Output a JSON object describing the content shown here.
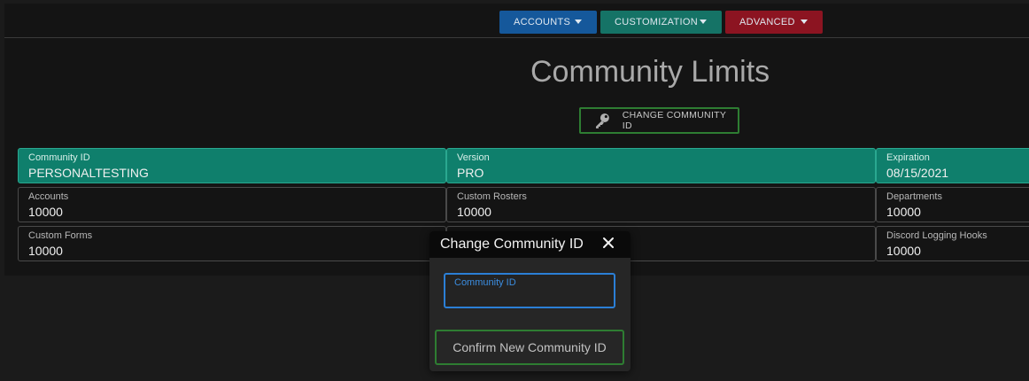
{
  "nav": {
    "accounts": "ACCOUNTS",
    "customization": "CUSTOMIZATION",
    "advanced": "ADVANCED"
  },
  "page": {
    "title": "Community Limits",
    "change_button": "CHANGE COMMUNITY ID"
  },
  "grid": {
    "community_id": {
      "label": "Community ID",
      "value": "PERSONALTESTING"
    },
    "version": {
      "label": "Version",
      "value": "PRO"
    },
    "expiration": {
      "label": "Expiration",
      "value": "08/15/2021"
    },
    "accounts": {
      "label": "Accounts",
      "value": "10000"
    },
    "custom_rosters": {
      "label": "Custom Rosters",
      "value": "10000"
    },
    "departments": {
      "label": "Departments",
      "value": "10000"
    },
    "custom_forms": {
      "label": "Custom Forms",
      "value": "10000"
    },
    "hidden_middle": {
      "label": "",
      "value": ""
    },
    "discord_hooks": {
      "label": "Discord Logging Hooks",
      "value": "10000"
    }
  },
  "modal": {
    "title": "Change Community ID",
    "field_label": "Community ID",
    "field_value": "",
    "confirm": "Confirm New Community ID"
  },
  "colors": {
    "accounts_nav": "#15589b",
    "customization_nav": "#157366",
    "advanced_nav": "#8c1421",
    "teal_row": "#0f7f6c",
    "confirm_border": "#2e7d32",
    "field_focus": "#2b7fd6"
  },
  "icons": {
    "nav_caret": "caret-down-icon",
    "change_button": "key-icon",
    "modal_close": "close-icon"
  }
}
